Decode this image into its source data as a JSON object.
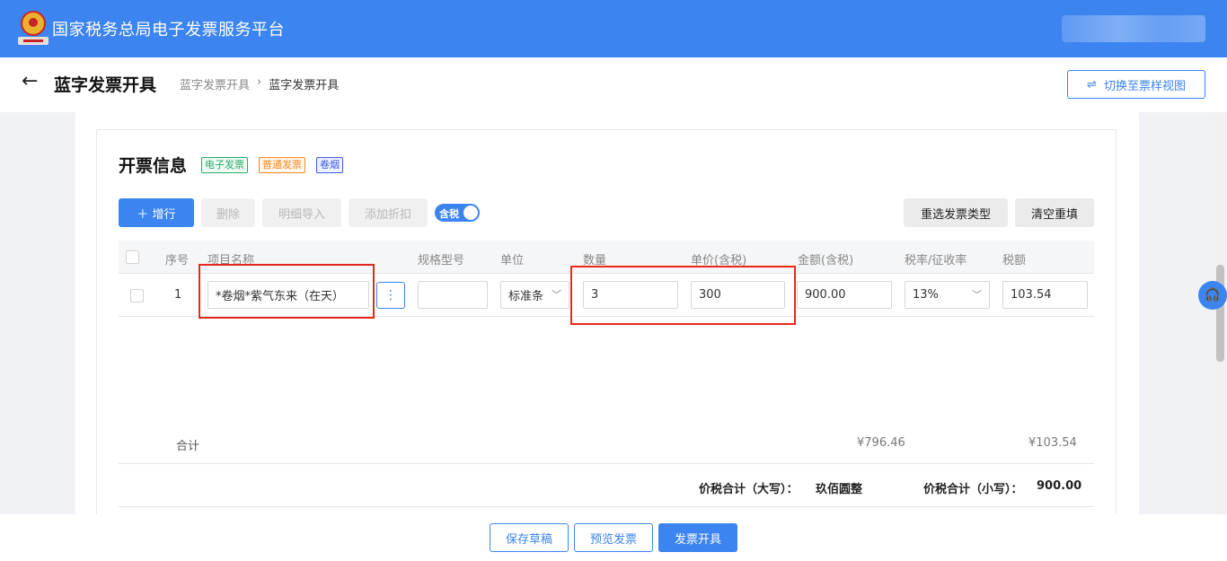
{
  "app": {
    "platform_title": "国家税务总局电子发票服务平台"
  },
  "header": {
    "page_title": "蓝字发票开具",
    "breadcrumb": [
      "蓝字发票开具",
      "›",
      "蓝字发票开具"
    ],
    "switch_view_label": "切换至票样视图",
    "switch_icon": "⇌"
  },
  "section": {
    "title": "开票信息",
    "tags": [
      "电子发票",
      "普通发票",
      "卷烟"
    ]
  },
  "toolbar": {
    "add_row_label": "＋ 增行",
    "delete_label": "删除",
    "import_label": "明细导入",
    "discount_label": "添加折扣",
    "tax_toggle_label": "含税",
    "tax_toggle_on": true,
    "reselect_label": "重选发票类型",
    "clear_label": "清空重填"
  },
  "table": {
    "columns": [
      "序号",
      "项目名称",
      "规格型号",
      "单位",
      "数量",
      "单价(含税)",
      "金额(含税)",
      "税率/征收率",
      "税额"
    ],
    "rows": [
      {
        "index": "1",
        "item_name": "*卷烟*紫气东来（在天）",
        "spec": "",
        "unit": "标准条",
        "quantity": "3",
        "unit_price": "300",
        "amount": "900.00",
        "tax_rate": "13%",
        "tax_amount": "103.54"
      }
    ],
    "more_icon": "⋮"
  },
  "summary": {
    "label": "合计",
    "amount_total": "¥796.46",
    "tax_total": "¥103.54",
    "upper_label": "价税合计（大写）：",
    "upper_value": "玖佰圆整",
    "lower_label": "价税合计（小写）：",
    "lower_value": "900.00"
  },
  "footer": {
    "save_draft_label": "保存草稿",
    "preview_label": "预览发票",
    "issue_label": "发票开具"
  },
  "colors": {
    "brand": "#3c84f0",
    "highlight": "#e8281d"
  }
}
